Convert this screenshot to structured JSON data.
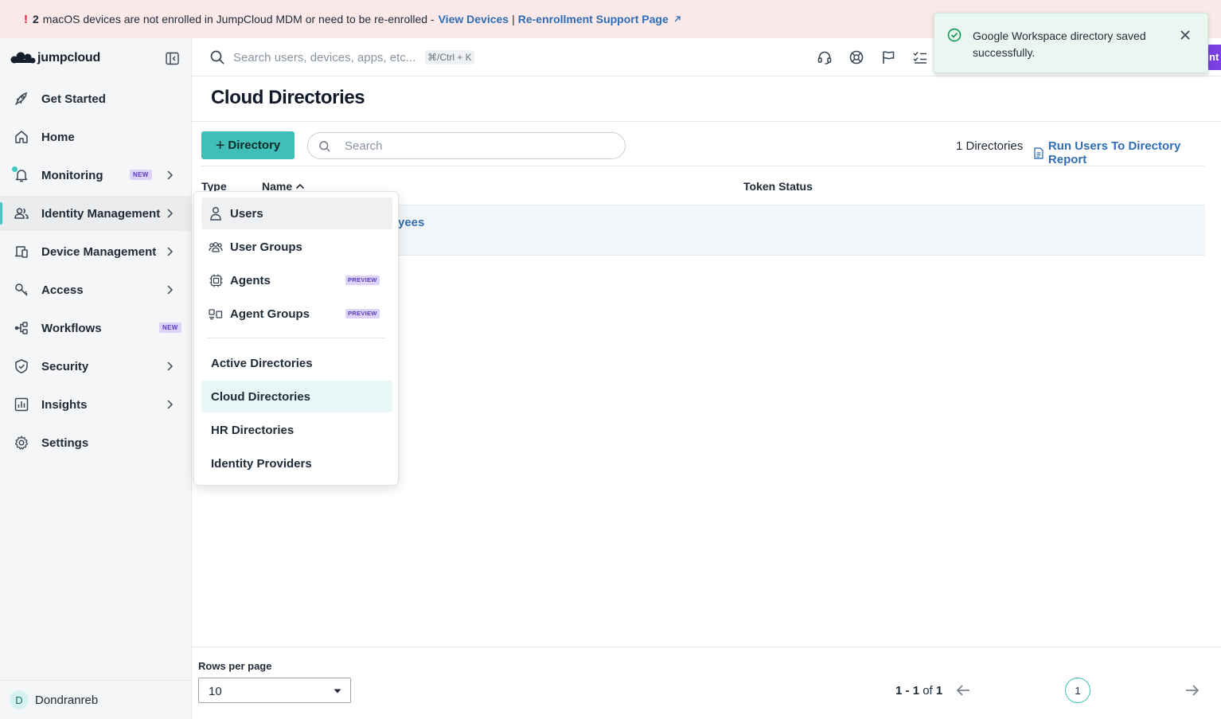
{
  "banner": {
    "count": "2",
    "message": "macOS devices are not enrolled in JumpCloud MDM or need to be re-enrolled -",
    "link_view_devices": "View Devices",
    "separator": "|",
    "link_support": "Re-enrollment Support Page"
  },
  "app": {
    "logo_text": "jumpcloud"
  },
  "topbar": {
    "search_placeholder": "Search users, devices, apps, etc...",
    "shortcut": "⌘/Ctrl + K",
    "edge_label": "nt"
  },
  "toast": {
    "message": "Google Workspace directory saved successfully."
  },
  "sidebar": {
    "items": [
      {
        "label": "Get Started",
        "icon": "rocket-icon"
      },
      {
        "label": "Home",
        "icon": "home-icon"
      },
      {
        "label": "Monitoring",
        "icon": "bell-icon",
        "badge": "NEW"
      },
      {
        "label": "Identity Management",
        "icon": "users-icon"
      },
      {
        "label": "Device Management",
        "icon": "devices-icon"
      },
      {
        "label": "Access",
        "icon": "key-icon"
      },
      {
        "label": "Workflows",
        "icon": "workflow-icon",
        "badge": "NEW"
      },
      {
        "label": "Security",
        "icon": "shield-icon"
      },
      {
        "label": "Insights",
        "icon": "chart-icon"
      },
      {
        "label": "Settings",
        "icon": "gear-icon"
      }
    ],
    "user": {
      "initial": "D",
      "name": "Dondranreb"
    }
  },
  "page": {
    "title": "Cloud Directories",
    "add_button": "Directory",
    "search_placeholder": "Search",
    "directory_count": "1 Directories",
    "report_link": "Run Users To Directory Report"
  },
  "table": {
    "columns": {
      "type": "Type",
      "name": "Name",
      "token_status": "Token Status"
    },
    "rows": [
      {
        "name_visible": "yees"
      }
    ]
  },
  "menu": {
    "items": [
      {
        "label": "Users",
        "icon": "user-icon"
      },
      {
        "label": "User Groups",
        "icon": "user-groups-icon"
      },
      {
        "label": "Agents",
        "icon": "chip-icon",
        "badge": "PREVIEW"
      },
      {
        "label": "Agent Groups",
        "icon": "agent-groups-icon",
        "badge": "PREVIEW"
      },
      {
        "label": "Active Directories"
      },
      {
        "label": "Cloud Directories"
      },
      {
        "label": "HR Directories"
      },
      {
        "label": "Identity Providers"
      }
    ]
  },
  "footer": {
    "rows_per_page_label": "Rows per page",
    "rows_per_page_value": "10",
    "range_start": "1",
    "range_dash": "-",
    "range_end": "1",
    "range_of": "of",
    "range_total": "1",
    "current_page": "1"
  },
  "colors": {
    "accent": "#3fbfb8",
    "link": "#2f6db5",
    "banner_bg": "#fbe9ea",
    "toast_bg": "#eaf7f0",
    "badge_bg": "#dcd3f7",
    "preview_purple": "#7b3fe4"
  }
}
